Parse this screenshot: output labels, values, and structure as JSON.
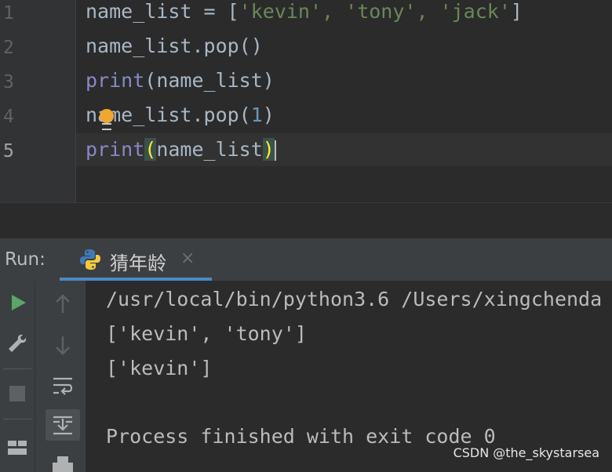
{
  "editor": {
    "line_numbers": [
      "1",
      "2",
      "3",
      "4",
      "5"
    ],
    "lines": [
      {
        "t1": "name_list = [",
        "s1": "'kevin'",
        "c1": ", ",
        "s2": "'tony'",
        "c2": ", ",
        "s3": "'jack'",
        "t2": "]"
      },
      {
        "text": "name_list.pop()"
      },
      {
        "kw": "print",
        "rest": "(name_list)"
      },
      {
        "t1": "name_list.pop(",
        "num": "1",
        "t2": ")"
      },
      {
        "kw": "print",
        "lp": "(",
        "mid": "name_list",
        "rp": ")"
      }
    ]
  },
  "run": {
    "label": "Run:",
    "tab_title": "猜年龄",
    "tab_close": "×"
  },
  "console": {
    "lines": [
      "/usr/local/bin/python3.6 /Users/xingchenda",
      "['kevin', 'tony']",
      "['kevin']",
      "",
      "Process finished with exit code 0"
    ]
  },
  "toolbar": {
    "icons": [
      "run-icon",
      "wrench-icon",
      "stop-icon",
      "layout-icon",
      "up-arrow-icon",
      "down-arrow-icon",
      "soft-wrap-icon",
      "scroll-to-end-icon",
      "print-icon"
    ]
  },
  "watermark": "CSDN @the_skystarsea",
  "colors": {
    "editor_bg": "#2b2b2b",
    "panel_bg": "#3c3f41",
    "string": "#6a8759",
    "number": "#6897bb",
    "builtin": "#8888c6",
    "accent": "#4a88c7",
    "run_green": "#59a869"
  }
}
